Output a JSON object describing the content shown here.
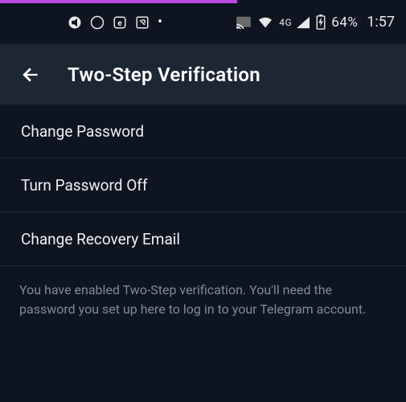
{
  "status": {
    "network_label": "4G",
    "battery_percent": "64%",
    "time": "1:57"
  },
  "appbar": {
    "title": "Two-Step Verification"
  },
  "items": [
    {
      "label": "Change Password"
    },
    {
      "label": "Turn Password Off"
    },
    {
      "label": "Change Recovery Email"
    }
  ],
  "hint": "You have enabled Two-Step verification. You'll need the password you set up here to log in to your Telegram account."
}
